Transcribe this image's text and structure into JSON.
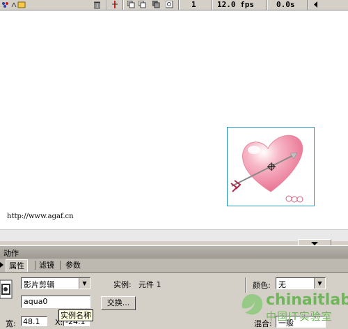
{
  "toolbar": {
    "frame_number": "1",
    "fps": "12.0 fps",
    "elapsed": "0.0s",
    "icons": [
      "add-layer-icon",
      "add-folder-icon",
      "delete-layer-icon",
      "center-frame-icon",
      "onion-skin-icon",
      "onion-outline-icon",
      "edit-multiple-frames-icon",
      "modify-onion-markers-icon",
      "scroll-left-icon"
    ]
  },
  "stage": {
    "url_text": "http://www.agaf.cn",
    "background": "#ffffff",
    "selection_color": "#2b9ac8"
  },
  "panels": {
    "actions_title": "动作",
    "tabs": [
      {
        "label": "属性",
        "active": true
      },
      {
        "label": "滤镜",
        "active": false
      },
      {
        "label": "参数",
        "active": false
      }
    ]
  },
  "properties": {
    "symbol_type": "影片剪辑",
    "instance_label": "实例:",
    "instance_value": "元件 1",
    "instance_name": "aqua0",
    "swap_button": "交换...",
    "color_label": "颜色:",
    "color_value": "无",
    "tooltip": "实例名称",
    "width_label": "宽:",
    "width_value": "48.1",
    "x_label": "X:",
    "x_value": "-24.1",
    "blend_label": "混合:",
    "blend_value": "一般"
  },
  "watermark": {
    "brand": "chinaitlab",
    "subtitle": "中国IT实验室",
    "color": "#6fb65a"
  }
}
